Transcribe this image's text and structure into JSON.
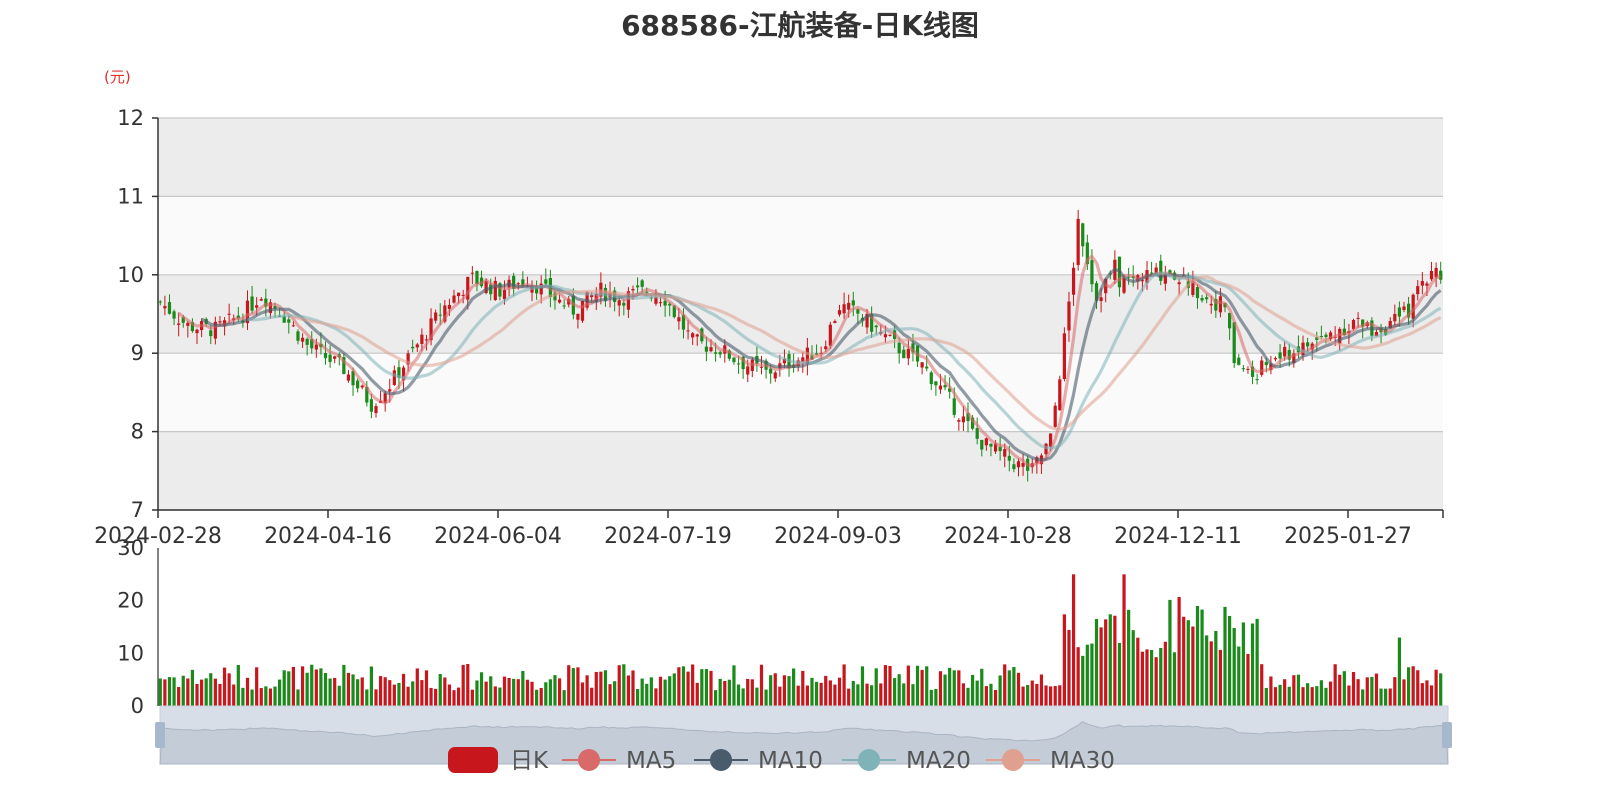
{
  "title": "688586-江航装备-日K线图",
  "unit": "(元)",
  "colors": {
    "up": "#c8161d",
    "down": "#1a8a1a",
    "ma5": "#d86a6a",
    "ma10": "#4a5b6b",
    "ma20": "#7fb3b8",
    "ma30": "#e0a090",
    "grid": "#c8c8c8",
    "bandA": "#fafafa",
    "bandB": "#ececec"
  },
  "legend": [
    "日K",
    "MA5",
    "MA10",
    "MA20",
    "MA30"
  ],
  "chart_data": [
    {
      "type": "candlestick",
      "title": "688586-江航装备-日K线图",
      "ylabel": "(元)",
      "ylim": [
        7,
        12
      ],
      "yticks": [
        7,
        8,
        9,
        10,
        11,
        12
      ],
      "xticks": [
        "2024-02-28",
        "2024-04-16",
        "2024-06-04",
        "2024-07-19",
        "2024-09-03",
        "2024-10-28",
        "2024-12-11",
        "2025-01-27"
      ],
      "n_days": 240,
      "close_anchors": [
        [
          0,
          9.65
        ],
        [
          6,
          9.35
        ],
        [
          12,
          9.3
        ],
        [
          18,
          9.5
        ],
        [
          22,
          9.75
        ],
        [
          26,
          9.55
        ],
        [
          32,
          9.1
        ],
        [
          40,
          8.8
        ],
        [
          46,
          8.35
        ],
        [
          50,
          8.6
        ],
        [
          56,
          9.1
        ],
        [
          62,
          9.6
        ],
        [
          68,
          9.95
        ],
        [
          74,
          9.8
        ],
        [
          80,
          9.95
        ],
        [
          86,
          9.7
        ],
        [
          90,
          9.55
        ],
        [
          96,
          9.8
        ],
        [
          100,
          9.7
        ],
        [
          106,
          9.8
        ],
        [
          110,
          9.7
        ],
        [
          116,
          9.15
        ],
        [
          122,
          9.05
        ],
        [
          126,
          8.9
        ],
        [
          132,
          8.75
        ],
        [
          138,
          8.9
        ],
        [
          144,
          9.05
        ],
        [
          148,
          9.6
        ],
        [
          152,
          9.5
        ],
        [
          156,
          9.3
        ],
        [
          160,
          9.1
        ],
        [
          166,
          8.85
        ],
        [
          172,
          8.4
        ],
        [
          178,
          7.9
        ],
        [
          186,
          7.6
        ],
        [
          190,
          7.5
        ],
        [
          194,
          7.9
        ],
        [
          198,
          9.6
        ],
        [
          200,
          10.7
        ],
        [
          204,
          9.7
        ],
        [
          208,
          10.1
        ],
        [
          214,
          10.5
        ],
        [
          218,
          10.2
        ],
        [
          222,
          10.5
        ],
        [
          226,
          10.9
        ],
        [
          230,
          10.5
        ],
        [
          234,
          10.2
        ],
        [
          240,
          9.9
        ]
      ],
      "close_anchors_late": [
        [
          0,
          9.9
        ],
        [
          4,
          9.95
        ],
        [
          8,
          10.0
        ],
        [
          12,
          10.05
        ],
        [
          16,
          9.9
        ],
        [
          20,
          9.7
        ],
        [
          24,
          9.6
        ],
        [
          26,
          8.9
        ],
        [
          30,
          8.7
        ],
        [
          34,
          8.9
        ],
        [
          40,
          9.05
        ],
        [
          46,
          9.2
        ],
        [
          52,
          9.4
        ],
        [
          56,
          9.3
        ],
        [
          60,
          9.35
        ],
        [
          64,
          9.55
        ],
        [
          68,
          10.0
        ],
        [
          72,
          10.05
        ]
      ],
      "series": [
        {
          "name": "日K"
        },
        {
          "name": "MA5"
        },
        {
          "name": "MA10"
        },
        {
          "name": "MA20"
        },
        {
          "name": "MA30"
        }
      ],
      "volume": {
        "ylim": [
          0,
          30
        ],
        "yticks": [
          0,
          10,
          20,
          30
        ]
      }
    }
  ]
}
